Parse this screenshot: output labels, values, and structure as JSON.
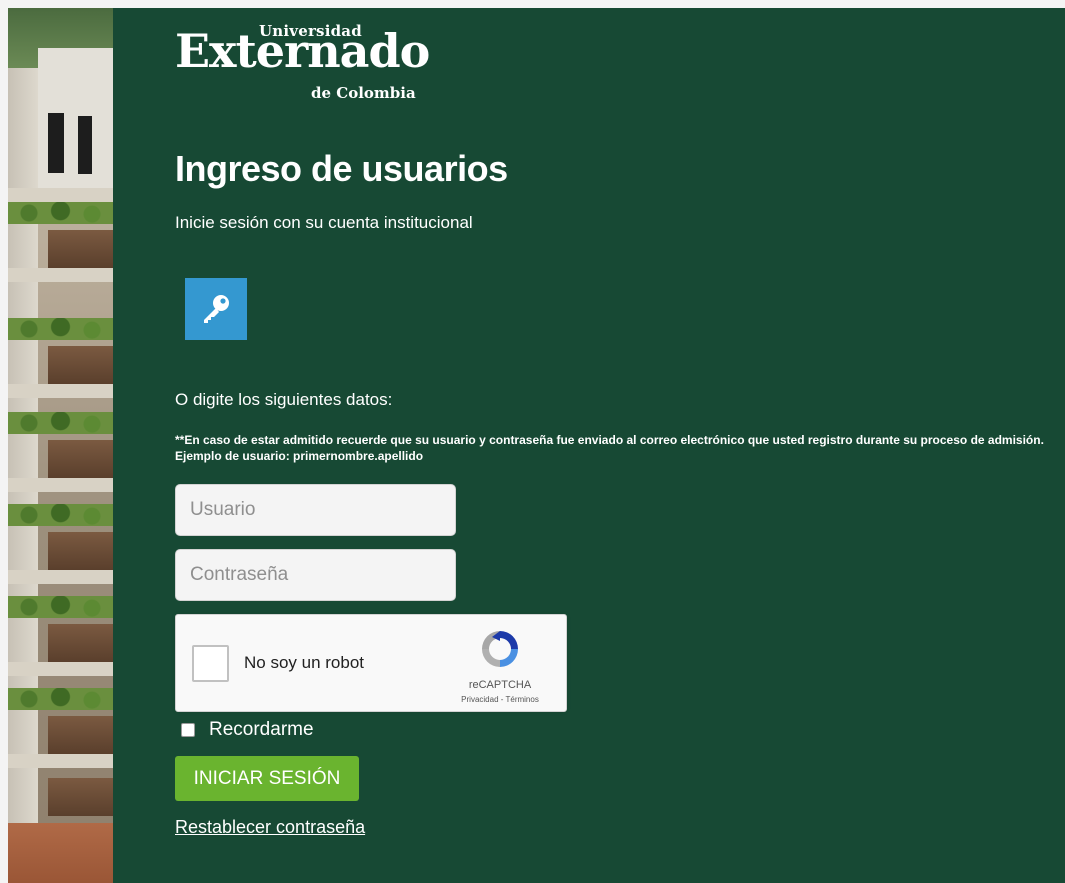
{
  "logo": {
    "top": "Universidad",
    "main": "Externado",
    "sub": "de Colombia"
  },
  "page": {
    "title": "Ingreso de usuarios",
    "subtitle": "Inicie sesión con su cuenta institucional",
    "sso_icon": "key-icon",
    "alt_heading": "O digite los siguientes datos:",
    "notice": "**En caso de estar admitido recuerde que su usuario y contraseña fue enviado al correo electrónico que usted registro durante su proceso de admisión. Ejemplo de usuario: primernombre.apellido"
  },
  "form": {
    "username_placeholder": "Usuario",
    "username_value": "",
    "password_placeholder": "Contraseña",
    "password_value": "",
    "captcha_label": "No soy un robot",
    "captcha_brand": "reCAPTCHA",
    "captcha_terms": "Privacidad - Términos",
    "remember_label": "Recordarme",
    "submit_label": "INICIAR SESIÓN",
    "reset_link": "Restablecer contraseña"
  },
  "colors": {
    "panel": "#174934",
    "key_button": "#3498d0",
    "submit_button": "#6ab42f"
  }
}
